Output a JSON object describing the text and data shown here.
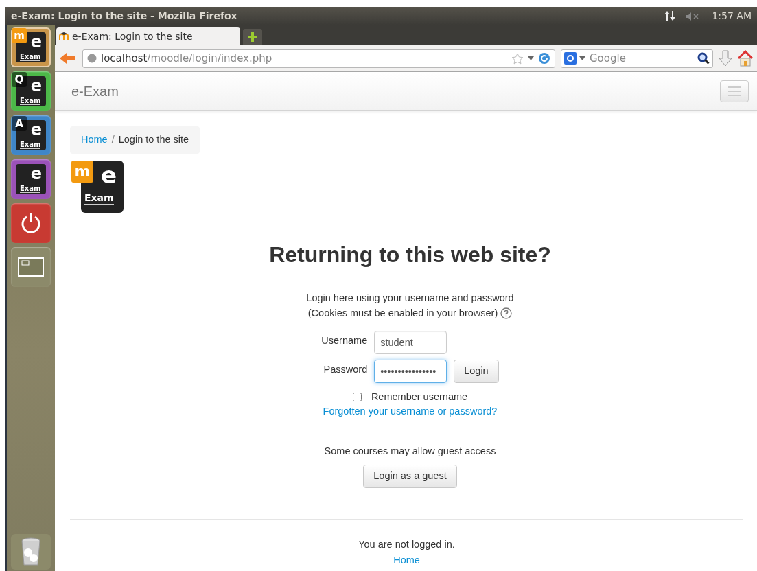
{
  "window": {
    "title": "e-Exam: Login to the site - Mozilla Firefox"
  },
  "panel": {
    "clock": "1:57 AM",
    "muted": true
  },
  "launcher": {
    "items": [
      {
        "kind": "exam",
        "badge": "m",
        "word": "e",
        "caption": "Exam",
        "color": "#c8954a",
        "selected": true
      },
      {
        "kind": "exam",
        "badge": "Q",
        "word": "e",
        "caption": "Exam",
        "color": "#4cb848",
        "selected": false
      },
      {
        "kind": "exam",
        "badge": "A",
        "word": "e",
        "caption": "Exam",
        "color": "#3f86c8",
        "selected": false
      },
      {
        "kind": "exam",
        "word": "e",
        "caption": "Exam",
        "color": "#9b52b8",
        "selected": false
      },
      {
        "kind": "power",
        "color": "#c83a32",
        "selected": false
      },
      {
        "kind": "workspace",
        "color": "#8c8a6a",
        "selected": false
      }
    ]
  },
  "tabs": [
    {
      "label": "e-Exam: Login to the site",
      "selected": true
    }
  ],
  "address": {
    "host": "localhost",
    "path": "/moodle/login/index.php"
  },
  "search": {
    "placeholder": "Google"
  },
  "navbar": {
    "brand": "e-Exam"
  },
  "breadcrumb_separator": "/",
  "breadcrumb": [
    {
      "label": "Home",
      "link": true
    },
    {
      "label": "Login to the site",
      "link": false
    }
  ],
  "logo": {
    "badge": "m",
    "word": "e",
    "caption": "Exam"
  },
  "login": {
    "heading": "Returning to this web site?",
    "intro": [
      "Login here using your username and password",
      "(Cookies must be enabled in your browser)"
    ],
    "username": {
      "label": "Username",
      "value": "student"
    },
    "password": {
      "label": "Password",
      "value": "••••••••••••••••",
      "focused": true
    },
    "submit": "Login",
    "remember": {
      "label": "Remember username",
      "checked": false
    },
    "forgot": "Forgotten your username or password?",
    "guest_note": "Some courses may allow guest access",
    "guest_button": "Login as a guest"
  },
  "footer": {
    "status": "You are not logged in.",
    "home": "Home"
  }
}
